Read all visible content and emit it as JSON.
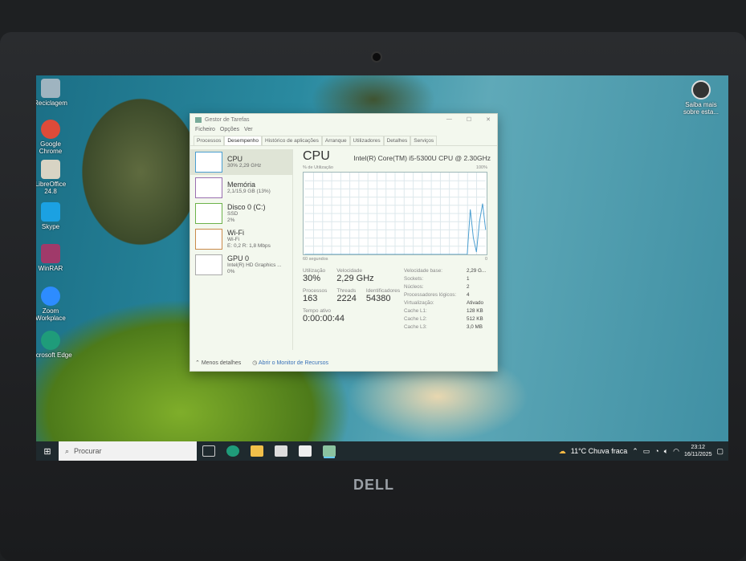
{
  "desktop": {
    "icons": [
      {
        "label": "Reciclagem",
        "color": "#9fb4c0"
      },
      {
        "label": "Google Chrome",
        "color": "#dd4b39"
      },
      {
        "label": "LibreOffice 24.8",
        "color": "#d8d4c4"
      },
      {
        "label": "Skype",
        "color": "#1ba1e2"
      },
      {
        "label": "WinRAR",
        "color": "#a03a6a"
      },
      {
        "label": "Zoom Workplace",
        "color": "#2d8cff"
      },
      {
        "label": "Microsoft Edge",
        "color": "#1f9c7a"
      }
    ],
    "right_icon": {
      "label": "Saiba mais sobre esta..."
    }
  },
  "task_manager": {
    "title": "Gestor de Tarefas",
    "menu": [
      "Ficheiro",
      "Opções",
      "Ver"
    ],
    "tabs": [
      "Processos",
      "Desempenho",
      "Histórico de aplicações",
      "Arranque",
      "Utilizadores",
      "Detalhes",
      "Serviços"
    ],
    "active_tab": "Desempenho",
    "sidebar": [
      {
        "name": "CPU",
        "line1": "30% 2,29 GHz",
        "line2": ""
      },
      {
        "name": "Memória",
        "line1": "2,1/15,9 GB (13%)",
        "line2": ""
      },
      {
        "name": "Disco 0 (C:)",
        "line1": "SSD",
        "line2": "2%"
      },
      {
        "name": "Wi-Fi",
        "line1": "Wi-Fi",
        "line2": "E: 0,2 R: 1,8 Mbps"
      },
      {
        "name": "GPU 0",
        "line1": "Intel(R) HD Graphics ...",
        "line2": "0%"
      }
    ],
    "heading": "CPU",
    "model": "Intel(R) Core(TM) i5-5300U CPU @ 2.30GHz",
    "graph": {
      "ylabel": "% de Utilização",
      "ymax_label": "100%",
      "xleft": "60 segundos",
      "xright": "0",
      "cpu_history": [
        0,
        0,
        0,
        0,
        0,
        0,
        0,
        0,
        0,
        0,
        0,
        0,
        0,
        0,
        0,
        0,
        0,
        0,
        0,
        0,
        0,
        0,
        0,
        0,
        0,
        0,
        0,
        0,
        0,
        0,
        0,
        0,
        0,
        0,
        0,
        0,
        0,
        0,
        0,
        0,
        0,
        0,
        0,
        0,
        0,
        0,
        0,
        0,
        0,
        0,
        0,
        0,
        0,
        0,
        55,
        20,
        3,
        40,
        62,
        30
      ]
    },
    "stats": {
      "utilizacao_label": "Utilização",
      "utilizacao": "30%",
      "velocidade_label": "Velocidade",
      "velocidade": "2,29 GHz",
      "processos_label": "Processos",
      "processos": "163",
      "threads_label": "Threads",
      "threads": "2224",
      "identificadores_label": "Identificadores",
      "identificadores": "54380",
      "tempo_label": "Tempo ativo",
      "tempo": "0:00:00:44"
    },
    "specs": [
      {
        "k": "Velocidade base:",
        "v": "2,29 G..."
      },
      {
        "k": "Sockets:",
        "v": "1"
      },
      {
        "k": "Núcleos:",
        "v": "2"
      },
      {
        "k": "Processadores lógicos:",
        "v": "4"
      },
      {
        "k": "Virtualização:",
        "v": "Ativado"
      },
      {
        "k": "Cache L1:",
        "v": "128 KB"
      },
      {
        "k": "Cache L2:",
        "v": "512 KB"
      },
      {
        "k": "Cache L3:",
        "v": "3,0 MB"
      }
    ],
    "footer": {
      "less": "Menos detalhes",
      "monitor": "Abrir o Monitor de Recursos"
    }
  },
  "taskbar": {
    "search_placeholder": "Procurar",
    "weather": "11°C  Chuva fraca",
    "time": "23:12",
    "date": "16/11/2025"
  },
  "brand": "DELL"
}
